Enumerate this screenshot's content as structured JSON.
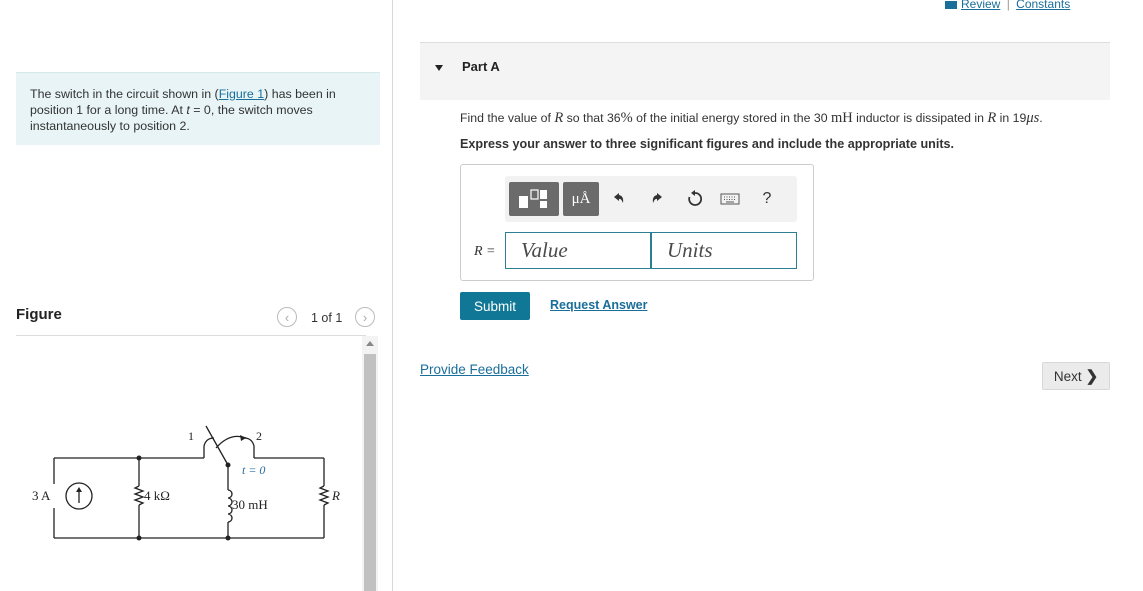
{
  "problem": {
    "line1_pre": "The switch in the circuit shown in (",
    "figure_link": "Figure 1",
    "line1_post": ") has been in",
    "line2_pre": "position 1 for a long time. At ",
    "t_var": "t",
    "line2_post": " = 0, the switch moves",
    "line3": "instantaneously to position 2."
  },
  "figure": {
    "label": "Figure",
    "counter": "1 of 1",
    "prev_icon": "chevron-left-icon",
    "next_icon": "chevron-right-icon",
    "circuit": {
      "source": "3 A",
      "resistor_4k": "4 kΩ",
      "inductor": "30 mH",
      "resistor_r": "R",
      "switch_pos1": "1",
      "switch_pos2": "2",
      "switch_time": "t = 0"
    }
  },
  "header_links": {
    "review": "Review",
    "separator": "|",
    "constants": "Constants"
  },
  "part": {
    "title": "Part A",
    "question_pre": "Find the value of ",
    "question_R": "R",
    "question_mid1": " so that 36",
    "question_pct": "%",
    "question_mid2": " of the initial energy stored in the 30 ",
    "question_mH": "mH",
    "question_mid3": " inductor is dissipated in ",
    "question_R2": "R",
    "question_mid4": " in 19",
    "question_us": "μs",
    "question_end": ".",
    "instruction": "Express your answer to three significant figures and include the appropriate units."
  },
  "toolbar": {
    "units_label": "μÅ",
    "icons": [
      "templates-icon",
      "units-icon",
      "undo-icon",
      "redo-icon",
      "reset-icon",
      "keyboard-icon",
      "help-icon"
    ],
    "help_label": "?"
  },
  "answer": {
    "var_label": "R =",
    "value_placeholder": "Value",
    "units_placeholder": "Units"
  },
  "actions": {
    "submit": "Submit",
    "request_answer": "Request Answer",
    "provide_feedback": "Provide Feedback",
    "next": "Next"
  },
  "colors": {
    "accent": "#107896",
    "link": "#1a6e9a",
    "problem_bg": "#e8f4f6"
  }
}
